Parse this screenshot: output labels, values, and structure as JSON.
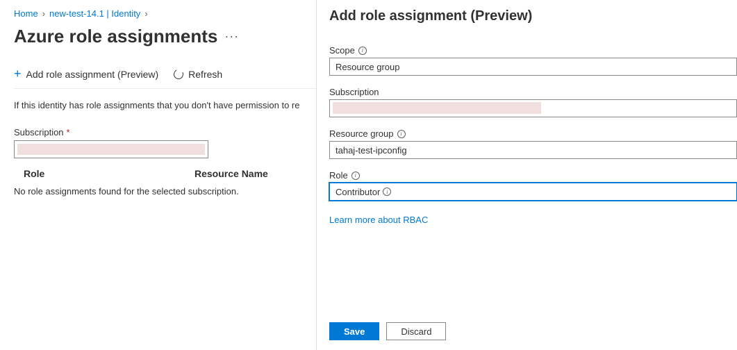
{
  "breadcrumb": {
    "home": "Home",
    "item": "new-test-14.1 | Identity"
  },
  "page": {
    "title": "Azure role assignments"
  },
  "toolbar": {
    "add": "Add role assignment (Preview)",
    "refresh": "Refresh"
  },
  "info_text": "If this identity has role assignments that you don't have permission to re",
  "subscription_label": "Subscription",
  "table": {
    "col_role": "Role",
    "col_resource": "Resource Name",
    "empty": "No role assignments found for the selected subscription."
  },
  "flyout": {
    "title": "Add role assignment (Preview)",
    "scope_label": "Scope",
    "scope_value": "Resource group",
    "subscription_label": "Subscription",
    "rg_label": "Resource group",
    "rg_value": "tahaj-test-ipconfig",
    "role_label": "Role",
    "role_value": "Contributor",
    "learn": "Learn more about RBAC",
    "save": "Save",
    "discard": "Discard"
  }
}
